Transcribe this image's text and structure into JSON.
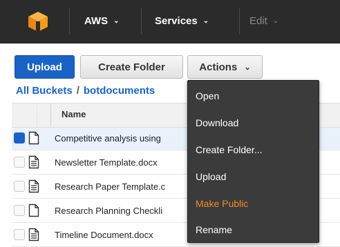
{
  "topnav": {
    "logo_icon": "aws-cube-logo-icon",
    "items": [
      {
        "label": "AWS",
        "caret": "⌄"
      },
      {
        "label": "Services",
        "caret": "⌄"
      },
      {
        "label": "Edit",
        "caret": "⌄"
      }
    ]
  },
  "toolbar": {
    "upload_label": "Upload",
    "create_folder_label": "Create Folder",
    "actions_label": "Actions",
    "actions_caret": "⌄"
  },
  "breadcrumb": {
    "root": "All Buckets",
    "separator": "/",
    "current": "botdocuments"
  },
  "table": {
    "column_name": "Name",
    "rows": [
      {
        "name": "Competitive analysis using",
        "icon": "blank-document-icon",
        "selected": true
      },
      {
        "name": "Newsletter Template.docx",
        "icon": "text-document-icon",
        "selected": false
      },
      {
        "name": "Research Paper Template.c",
        "icon": "text-document-icon",
        "selected": false
      },
      {
        "name": "Research Planning Checkli",
        "icon": "blank-document-icon",
        "selected": false
      },
      {
        "name": "Timeline Document.docx",
        "icon": "text-document-icon",
        "selected": false
      }
    ]
  },
  "actions_menu": {
    "items": [
      {
        "label": "Open"
      },
      {
        "label": "Download"
      },
      {
        "label": "Create Folder..."
      },
      {
        "label": "Upload"
      },
      {
        "label": "Make Public"
      },
      {
        "label": "Rename"
      }
    ]
  },
  "colors": {
    "topnav_bg": "#2b2b2b",
    "primary": "#1a63c6",
    "menu_bg": "#3b3b3b",
    "menu_highlight": "#f08a24",
    "logo": "#f49b1d"
  }
}
